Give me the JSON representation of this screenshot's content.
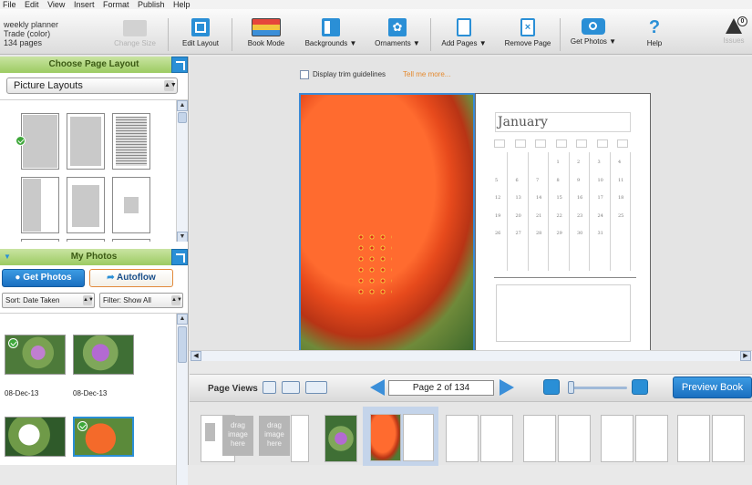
{
  "menu": [
    "File",
    "Edit",
    "View",
    "Insert",
    "Format",
    "Publish",
    "Help"
  ],
  "book": {
    "title": "weekly planner",
    "format": "Trade (color)",
    "pages": "134 pages"
  },
  "toolbar": {
    "change_size": "Change Size",
    "edit_layout": "Edit Layout",
    "book_mode": "Book Mode",
    "backgrounds": "Backgrounds ▼",
    "ornaments": "Ornaments ▼",
    "add_pages": "Add Pages ▼",
    "remove_page": "Remove Page",
    "get_photos": "Get Photos ▼",
    "help": "Help",
    "issues": "Issues",
    "issues_count": "0"
  },
  "layout_panel": {
    "title": "Choose Page Layout",
    "selected": "Picture Layouts"
  },
  "photos_panel": {
    "title": "My Photos",
    "get_photos": "Get Photos",
    "autoflow": "Autoflow",
    "sort": "Sort: Date Taken",
    "filter": "Filter: Show All",
    "photos": [
      {
        "date": "08-Dec-13",
        "used": true
      },
      {
        "date": "08-Dec-13",
        "used": false
      },
      {
        "date": "",
        "used": false
      },
      {
        "date": "",
        "used": true
      }
    ]
  },
  "canvas": {
    "trim_label": "Display trim guidelines",
    "tell_more": "Tell me more...",
    "month": "January",
    "days": [
      "1",
      "2",
      "3",
      "4",
      "5",
      "6",
      "7",
      "8",
      "9",
      "10",
      "11",
      "12",
      "13",
      "14",
      "15",
      "16",
      "17",
      "18",
      "19",
      "20",
      "21",
      "22",
      "23",
      "24",
      "25",
      "26",
      "27",
      "28",
      "29",
      "30",
      "31"
    ]
  },
  "page_views": {
    "label": "Page Views",
    "page": "Page 2 of 134",
    "preview": "Preview Book"
  },
  "filmstrip": {
    "drag_text": "drag image here"
  },
  "colors": {
    "accent_blue": "#1a79cf",
    "panel_green": "#9ccb62",
    "orange_link": "#e58a2f"
  }
}
